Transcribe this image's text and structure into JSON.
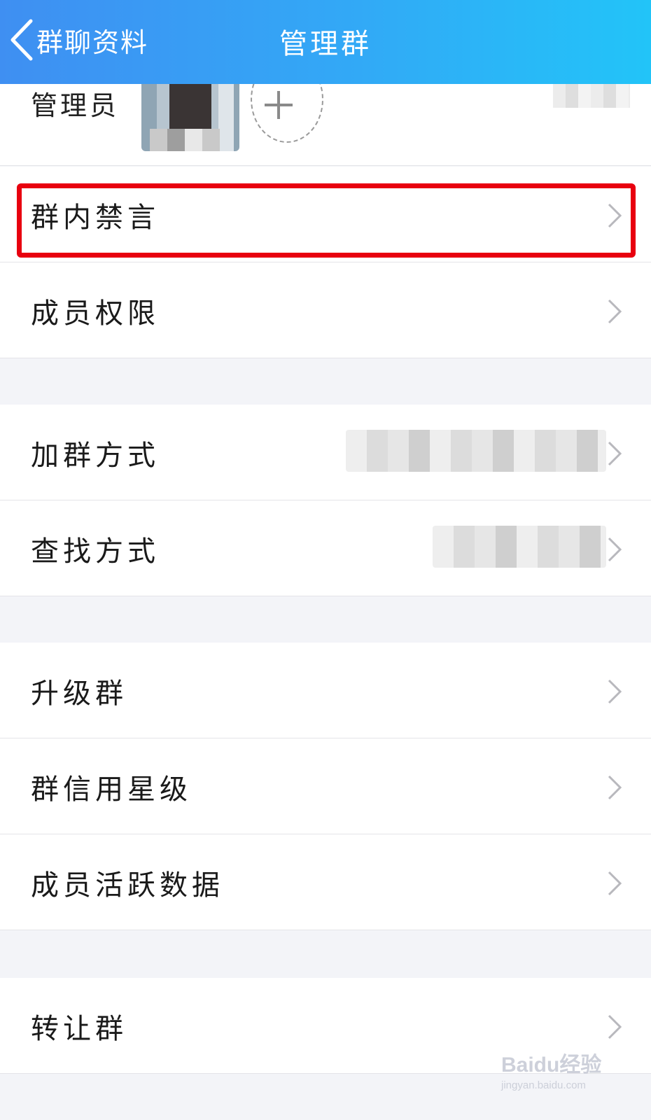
{
  "header": {
    "back_label": "群聊资料",
    "title": "管理群"
  },
  "admin_row": {
    "label": "管理员"
  },
  "items": [
    {
      "label": "群内禁言"
    },
    {
      "label": "成员权限"
    },
    {
      "label": "加群方式"
    },
    {
      "label": "查找方式"
    },
    {
      "label": "升级群"
    },
    {
      "label": "群信用星级"
    },
    {
      "label": "成员活跃数据"
    },
    {
      "label": "转让群"
    }
  ],
  "highlight": {
    "target": "群内禁言",
    "color": "#e8000f"
  },
  "watermark": {
    "brand": "Baidu经验",
    "url": "jingyan.baidu.com"
  },
  "colors": {
    "navbar_start": "#3f8ff2",
    "navbar_end": "#22c4f8",
    "background": "#f3f4f8"
  }
}
